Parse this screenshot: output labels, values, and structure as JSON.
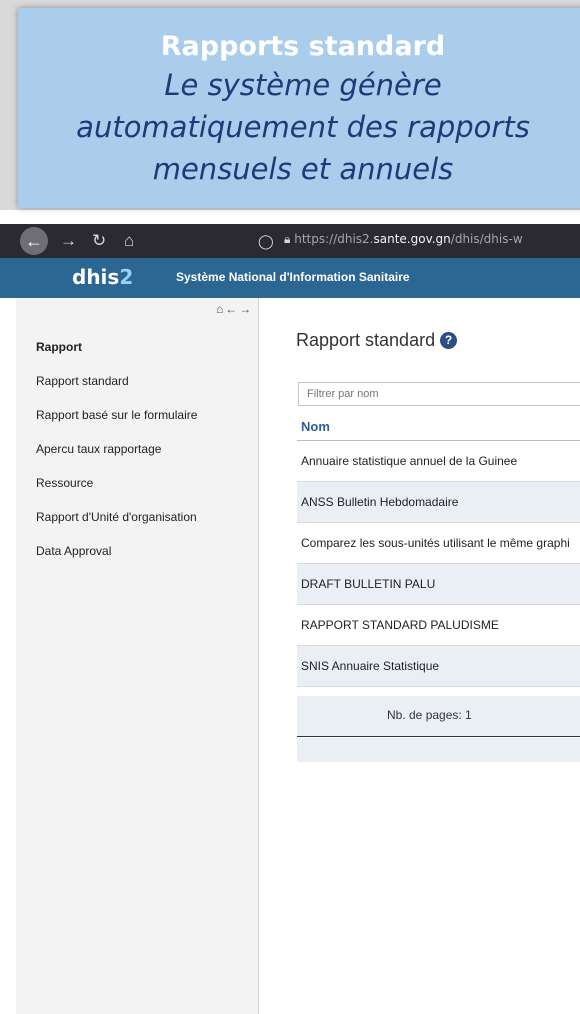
{
  "banner": {
    "title": "Rapports standard",
    "subtitle_lines": [
      "Le système génère",
      "automatiquement des rapports",
      "mensuels et annuels"
    ]
  },
  "browser": {
    "url_prefix": "https://dhis2.",
    "url_domain": "sante.gov.gn",
    "url_path": "/dhis/dhis-w"
  },
  "header": {
    "logo_text": "dhis",
    "logo_number": "2",
    "title": "Système National d'Information Sanitaire"
  },
  "sidebar": {
    "heading": "Rapport",
    "items": [
      {
        "label": "Rapport standard"
      },
      {
        "label": "Rapport basé sur le formulaire"
      },
      {
        "label": "Apercu taux rapportage"
      },
      {
        "label": "Ressource"
      },
      {
        "label": "Rapport d'Unité d'organisation"
      },
      {
        "label": "Data Approval"
      }
    ]
  },
  "main": {
    "title": "Rapport standard",
    "filter_placeholder": "Filtrer par nom",
    "column_header": "Nom",
    "rows": [
      {
        "name": "Annuaire statistique annuel de la Guinee"
      },
      {
        "name": "ANSS Bulletin Hebdomadaire"
      },
      {
        "name": "Comparez les sous-unités utilisant le même graphi"
      },
      {
        "name": "DRAFT BULLETIN PALU"
      },
      {
        "name": "RAPPORT STANDARD PALUDISME"
      },
      {
        "name": "SNIS Annuaire Statistique"
      }
    ],
    "pager_text": "Nb. de pages: 1"
  }
}
